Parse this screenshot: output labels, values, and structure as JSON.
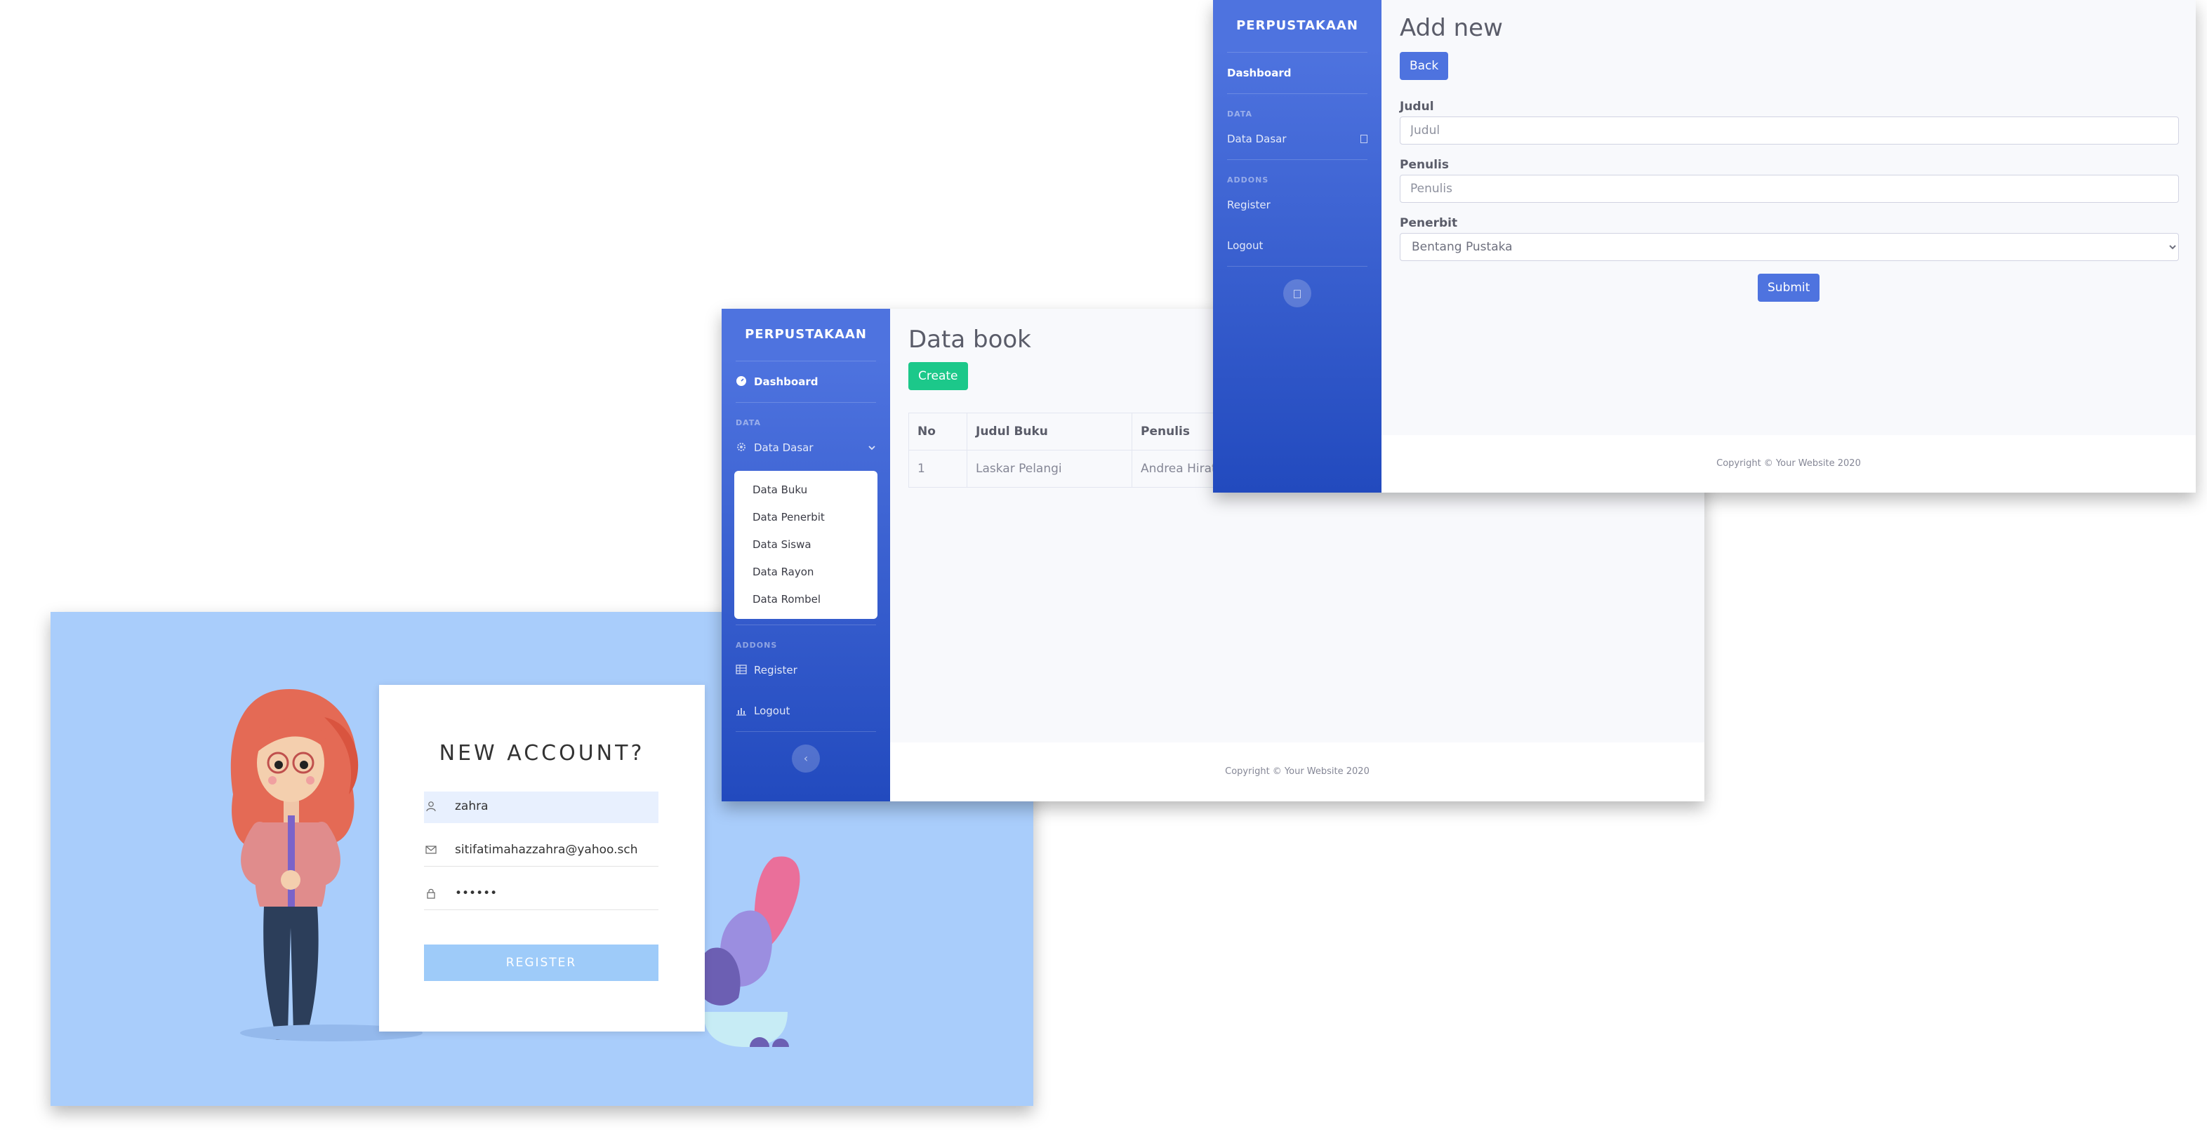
{
  "register": {
    "title": "NEW ACCOUNT?",
    "username": "zahra",
    "email": "sitifatimahazzahra@yahoo.sch",
    "password": "••••••",
    "button": "REGISTER"
  },
  "books": {
    "brand": "PERPUSTAKAAN",
    "nav": {
      "dashboard": "Dashboard",
      "heading_data": "DATA",
      "data_dasar": "Data Dasar",
      "submenu": [
        "Data Buku",
        "Data Penerbit",
        "Data Siswa",
        "Data Rayon",
        "Data Rombel"
      ],
      "heading_addons": "ADDONS",
      "register": "Register",
      "logout": "Logout"
    },
    "page_title": "Data book",
    "create_label": "Create",
    "table": {
      "headers": [
        "No",
        "Judul Buku",
        "Penulis"
      ],
      "rows": [
        [
          "1",
          "Laskar Pelangi",
          "Andrea Hirata"
        ]
      ]
    },
    "footer": "Copyright © Your Website 2020"
  },
  "addnew": {
    "brand": "PERPUSTAKAAN",
    "nav": {
      "dashboard": "Dashboard",
      "heading_data": "DATA",
      "data_dasar": "Data Dasar",
      "heading_addons": "ADDONS",
      "register": "Register",
      "logout": "Logout"
    },
    "page_title": "Add new",
    "back_label": "Back",
    "form": {
      "judul_label": "Judul",
      "judul_placeholder": "Judul",
      "penulis_label": "Penulis",
      "penulis_placeholder": "Penulis",
      "penerbit_label": "Penerbit",
      "penerbit_selected": "Bentang Pustaka"
    },
    "submit_label": "Submit",
    "footer": "Copyright © Your Website 2020"
  },
  "colors": {
    "primary": "#4e73df",
    "success": "#1cc88a",
    "register_bg": "#a9cdfb",
    "register_button": "#9ecbf9"
  }
}
